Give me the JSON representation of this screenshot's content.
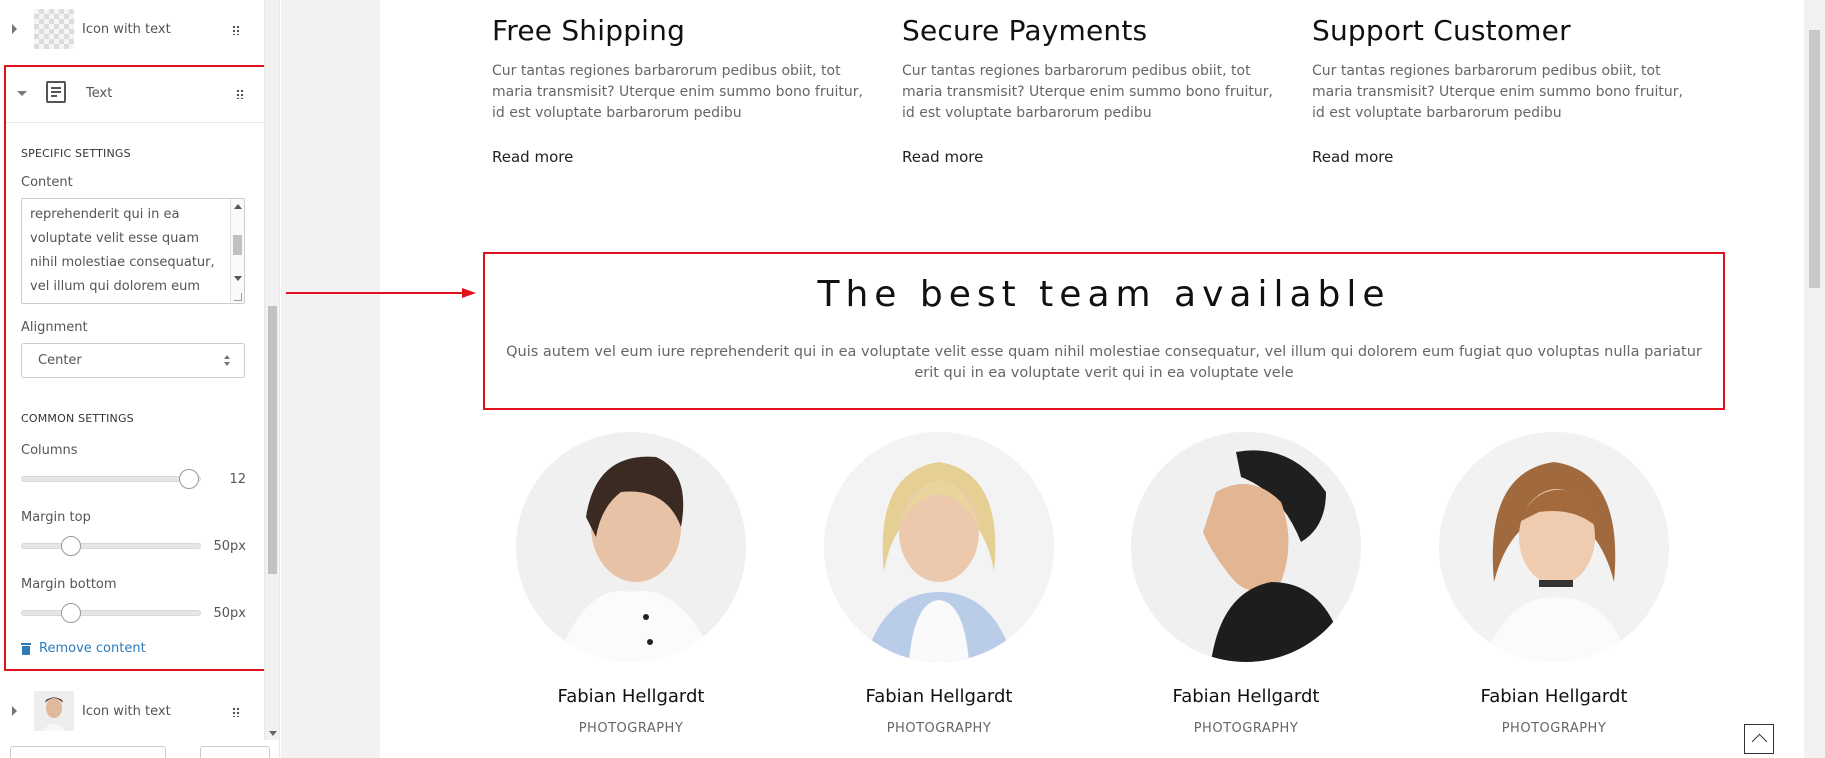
{
  "panel": {
    "item_top": {
      "label": "Icon with text"
    },
    "text_block": {
      "label": "Text",
      "specific_settings": "SPECIFIC SETTINGS",
      "content_label": "Content",
      "content_value": "reprehenderit qui in ea voluptate velit esse quam nihil molestiae consequatur, vel illum qui dolorem eum fugiat quo voluptas nulla",
      "alignment_label": "Alignment",
      "alignment_value": "Center",
      "common_settings": "COMMON SETTINGS",
      "columns_label": "Columns",
      "columns_value": "12",
      "margin_top_label": "Margin top",
      "margin_top_value": "50px",
      "margin_bottom_label": "Margin bottom",
      "margin_bottom_value": "50px",
      "remove_label": "Remove content"
    },
    "item_bottom": {
      "label": "Icon with text"
    }
  },
  "features": [
    {
      "title": "Free Shipping",
      "text": "Cur tantas regiones barbarorum pedibus obiit, tot maria transmisit? Uterque enim summo bono fruitur, id est voluptate barbarorum pedibu",
      "link": "Read more"
    },
    {
      "title": "Secure Payments",
      "text": "Cur tantas regiones barbarorum pedibus obiit, tot maria transmisit? Uterque enim summo bono fruitur, id est voluptate barbarorum pedibu",
      "link": "Read more"
    },
    {
      "title": "Support Customer",
      "text": "Cur tantas regiones barbarorum pedibus obiit, tot maria transmisit? Uterque enim summo bono fruitur, id est voluptate barbarorum pedibu",
      "link": "Read more"
    }
  ],
  "team": {
    "title": "The best team available",
    "text": "Quis autem vel eum iure reprehenderit qui in ea voluptate velit esse quam nihil molestiae consequatur, vel illum qui dolorem eum fugiat quo voluptas nulla pariatur erit qui in ea voluptate verit qui in ea voluptate vele",
    "members": [
      {
        "name": "Fabian Hellgardt",
        "role": "PHOTOGRAPHY"
      },
      {
        "name": "Fabian Hellgardt",
        "role": "PHOTOGRAPHY"
      },
      {
        "name": "Fabian Hellgardt",
        "role": "PHOTOGRAPHY"
      },
      {
        "name": "Fabian Hellgardt",
        "role": "PHOTOGRAPHY"
      }
    ]
  },
  "icons": {
    "drag": "drag-handle-icon",
    "doc": "text-document-icon",
    "trash": "trash-icon",
    "scroll_top": "chevron-up-icon"
  },
  "colors": {
    "highlight": "#e0111d",
    "link": "#2b7bbd"
  }
}
